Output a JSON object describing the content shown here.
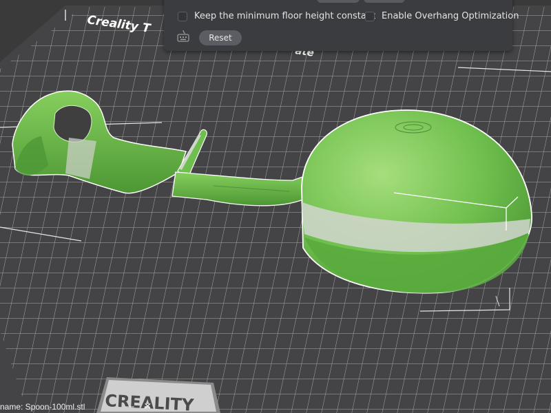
{
  "bed": {
    "title_partial": "Creality T",
    "title_tail": "ate",
    "brand": "CREALITY"
  },
  "panel": {
    "checkbox_keep_floor": {
      "label": "Keep the minimum floor height constant",
      "checked": false
    },
    "checkbox_overhang": {
      "label": "Enable Overhang Optimization",
      "checked": false
    },
    "reset_label": "Reset"
  },
  "status": {
    "filename": "name: Spoon-100ml.stl",
    "minimize_symbol": "—",
    "close_symbol": "✕"
  },
  "colors": {
    "model_green": "#6cc04a",
    "model_highlight": "#a8e07c",
    "bed": "#3e3e3e",
    "grid": "#c8c8c8"
  }
}
